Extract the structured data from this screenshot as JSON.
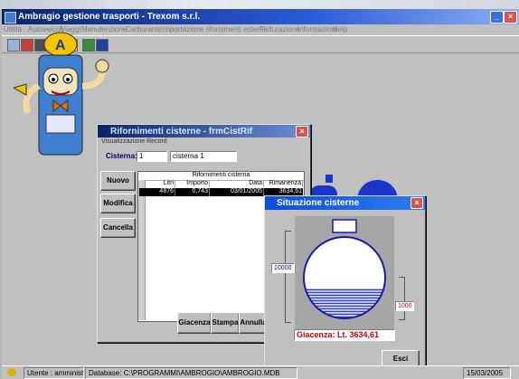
{
  "app": {
    "title": "Ambragio gestione trasporti - Trexom s.r.l.",
    "menu": [
      "Utilità",
      "Autoveicoli",
      "Viaggi",
      "Manutenzione",
      "Carburante",
      "Importazione rifornimenti esterni",
      "Fatturazione",
      "Informazioni",
      "Help"
    ],
    "toolbar_icons": [
      "truck-icon",
      "truck-red-icon",
      "cart-icon",
      "shield-icon",
      "clock-icon",
      "person-icon",
      "monitor-icon"
    ]
  },
  "rifornimenti": {
    "title": "Rifornimenti cisterne - frmCistRif",
    "subtitle": "Visualizzazione Record",
    "cisterna_label": "Cisterna:",
    "cisterna_number": "1",
    "cisterna_name": "cisterna 1",
    "buttons": {
      "nuovo": "Nuovo",
      "modifica": "Modifica",
      "cancella": "Cancella",
      "giacenza": "Giacenza",
      "stampa": "Stampa",
      "annulla": "Annulla"
    },
    "grid_caption": "Rifornimenti cisterna",
    "columns": [
      "Litri",
      "Importo",
      "Data",
      "Rimanenza"
    ],
    "rows": [
      {
        "litri": "4876",
        "importo": "0,743",
        "data": "03/01/2005",
        "rimanenza": "3634,61"
      }
    ]
  },
  "situazione": {
    "title": "Situazione cisterne",
    "capacity": "10000",
    "level_marker": "1000",
    "fill_fraction": 0.36,
    "giacenza_text": "Giacenza: Lt. 3634,61",
    "esci": "Esci"
  },
  "status": {
    "user": "Utente : amministratore",
    "database": "Database: C:\\PROGRAMMI\\AMBROGIO\\AMBROGIO.MDB",
    "date": "15/03/2005"
  },
  "colors": {
    "tank_outline": "#1a1aaa",
    "tank_fill": "#2a3fcc",
    "accent_red": "#cc0000"
  }
}
